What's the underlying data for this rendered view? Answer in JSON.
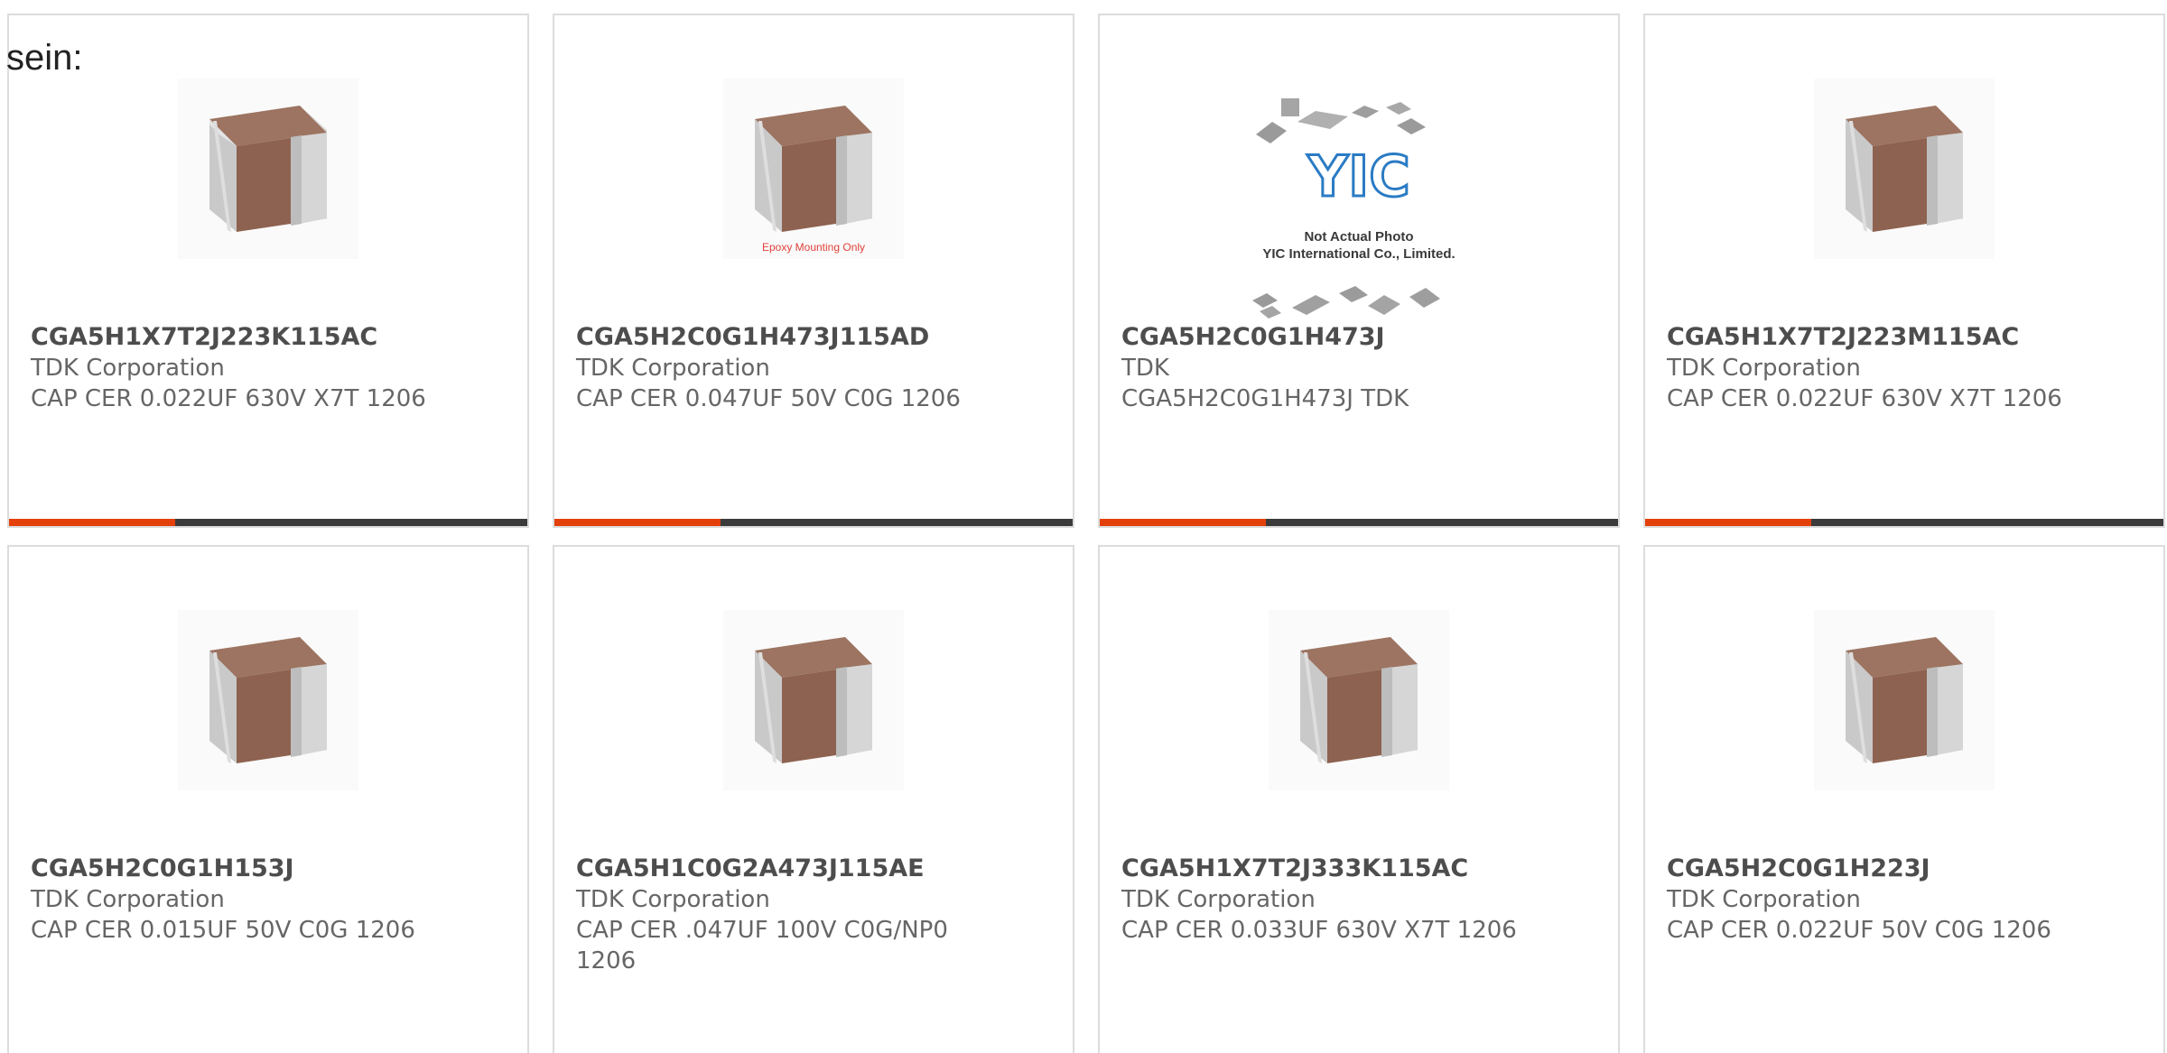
{
  "intro": {
    "text": "sein:"
  },
  "colors": {
    "accent": "#e4400c",
    "bar_dark": "#3b3b3b",
    "card_border": "#dcdcdc",
    "part_text": "#4d4d4d",
    "meta_text": "#666666"
  },
  "products": [
    {
      "part": "CGA5H1X7T2J223K115AC",
      "manufacturer": "TDK Corporation",
      "description": "CAP CER 0.022UF 630V X7T 1206",
      "image_icon": "ceramic-capacitor-icon",
      "accent_fraction": 0.32
    },
    {
      "part": "CGA5H2C0G1H473J115AD",
      "manufacturer": "TDK Corporation",
      "description": "CAP CER 0.047UF 50V C0G 1206",
      "image_icon": "ceramic-capacitor-icon",
      "image_note": "Epoxy Mounting Only",
      "accent_fraction": 0.32
    },
    {
      "part": "CGA5H2C0G1H473J",
      "manufacturer": "TDK",
      "description": "CGA5H2C0G1H473J TDK",
      "image_icon": "yic-placeholder-icon",
      "image_brand": "YIC",
      "image_note_line1": "Not Actual Photo",
      "image_note_line2": "YIC International Co., Limited.",
      "accent_fraction": 0.32
    },
    {
      "part": "CGA5H1X7T2J223M115AC",
      "manufacturer": "TDK Corporation",
      "description": "CAP CER 0.022UF 630V X7T 1206",
      "image_icon": "ceramic-capacitor-icon",
      "accent_fraction": 0.32
    },
    {
      "part": "CGA5H2C0G1H153J",
      "manufacturer": "TDK Corporation",
      "description": "CAP CER 0.015UF 50V C0G 1206",
      "image_icon": "ceramic-capacitor-icon"
    },
    {
      "part": "CGA5H1C0G2A473J115AE",
      "manufacturer": "TDK Corporation",
      "description": "CAP CER .047UF 100V C0G/NP0 1206",
      "image_icon": "ceramic-capacitor-icon"
    },
    {
      "part": "CGA5H1X7T2J333K115AC",
      "manufacturer": "TDK Corporation",
      "description": "CAP CER 0.033UF 630V X7T 1206",
      "image_icon": "ceramic-capacitor-icon"
    },
    {
      "part": "CGA5H2C0G1H223J",
      "manufacturer": "TDK Corporation",
      "description": "CAP CER 0.022UF 50V C0G 1206",
      "image_icon": "ceramic-capacitor-icon"
    }
  ]
}
